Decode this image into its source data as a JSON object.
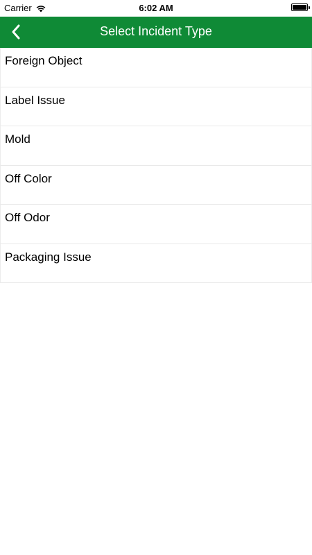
{
  "status_bar": {
    "carrier": "Carrier",
    "time": "6:02 AM",
    "wifi_icon": "wifi-icon",
    "battery_icon": "battery-icon"
  },
  "nav_bar": {
    "title": "Select Incident Type",
    "back_icon": "chevron-left-icon",
    "background_color": "#0f8a36"
  },
  "incident_types": [
    {
      "label": "Foreign Object"
    },
    {
      "label": "Label Issue"
    },
    {
      "label": "Mold"
    },
    {
      "label": "Off Color"
    },
    {
      "label": "Off Odor"
    },
    {
      "label": "Packaging Issue"
    }
  ]
}
